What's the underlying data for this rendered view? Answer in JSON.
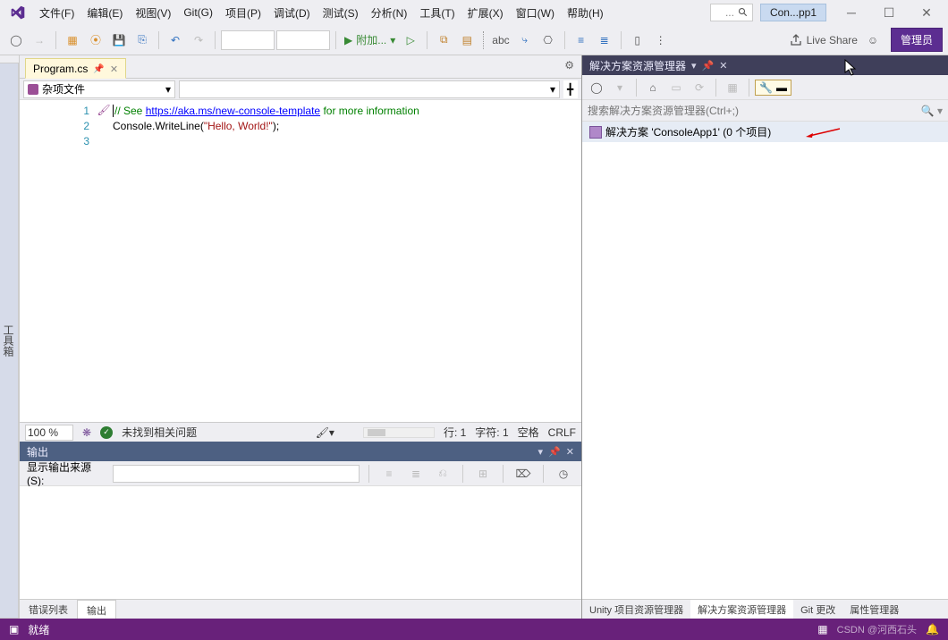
{
  "menubar": {
    "items": [
      "文件(F)",
      "编辑(E)",
      "视图(V)",
      "Git(G)",
      "项目(P)",
      "调试(D)",
      "测试(S)",
      "分析(N)",
      "工具(T)",
      "扩展(X)",
      "窗口(W)",
      "帮助(H)"
    ],
    "search_placeholder": "...",
    "project_tab": "Con...pp1"
  },
  "toolbar": {
    "run_label": "附加...",
    "liveshare": "Live Share",
    "admin": "管理员"
  },
  "sidebar": {
    "toolbox": "工具箱"
  },
  "editor": {
    "tab": "Program.cs",
    "crumbs": {
      "project": "杂项文件"
    },
    "lines": [
      "1",
      "2",
      "3"
    ],
    "code": {
      "l1_pre": "// See ",
      "l1_link": "https://aka.ms/new-console-template",
      "l1_post": " for more information",
      "l2_pre": "Console.WriteLine(",
      "l2_str": "\"Hello, World!\"",
      "l2_post": ");"
    },
    "status": {
      "zoom": "100 %",
      "issues": "未找到相关问题",
      "line": "行: 1",
      "col": "字符: 1",
      "spc": "空格",
      "eol": "CRLF"
    }
  },
  "output": {
    "title": "输出",
    "source_label": "显示输出来源(S):",
    "tabs": [
      "错误列表",
      "输出"
    ]
  },
  "solution": {
    "title": "解决方案资源管理器",
    "search_placeholder": "搜索解决方案资源管理器(Ctrl+;)",
    "root": "解决方案 'ConsoleApp1' (0 个项目)",
    "tabs": [
      "Unity 项目资源管理器",
      "解决方案资源管理器",
      "Git 更改",
      "属性管理器"
    ]
  },
  "statusbar": {
    "ready": "就绪",
    "watermark": "CSDN @河西石头"
  }
}
